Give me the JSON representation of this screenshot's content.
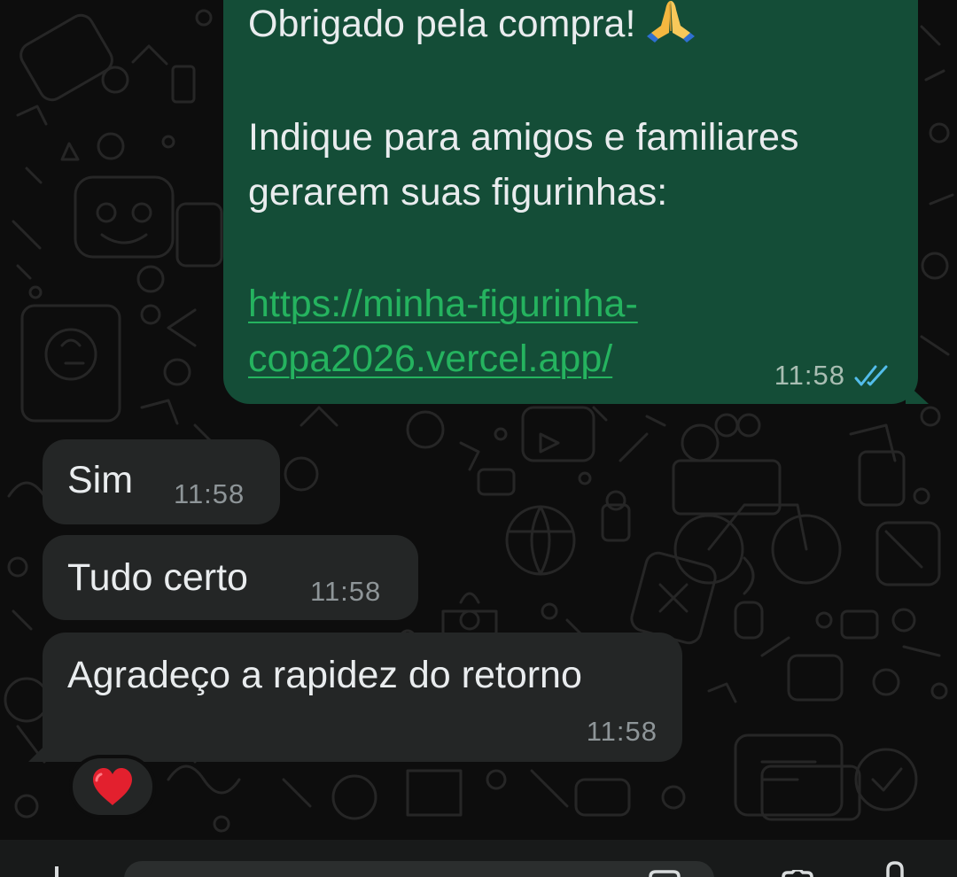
{
  "outgoing_message": {
    "line1": "Obrigado pela compra!",
    "line2": "Indique para amigos e familiares",
    "line3": "gerarem suas figurinhas:",
    "link_line1": "https://minha-figurinha-",
    "link_line2": "copa2026.vercel.app/",
    "time": "11:58",
    "status_icon": "double-check-read-icon",
    "emoji": "folded-hands"
  },
  "incoming_messages": [
    {
      "text": "Sim",
      "time": "11:58"
    },
    {
      "text": "Tudo certo",
      "time": "11:58"
    },
    {
      "text": "Agradeço a rapidez do retorno",
      "time": "11:58"
    }
  ],
  "reaction": {
    "emoji": "red-heart"
  },
  "colors": {
    "background": "#0d0d0d",
    "outgoing_bubble": "#144d37",
    "incoming_bubble": "#242626",
    "link": "#25b35f",
    "read_check": "#53bdeb",
    "text": "#e9ecee"
  }
}
